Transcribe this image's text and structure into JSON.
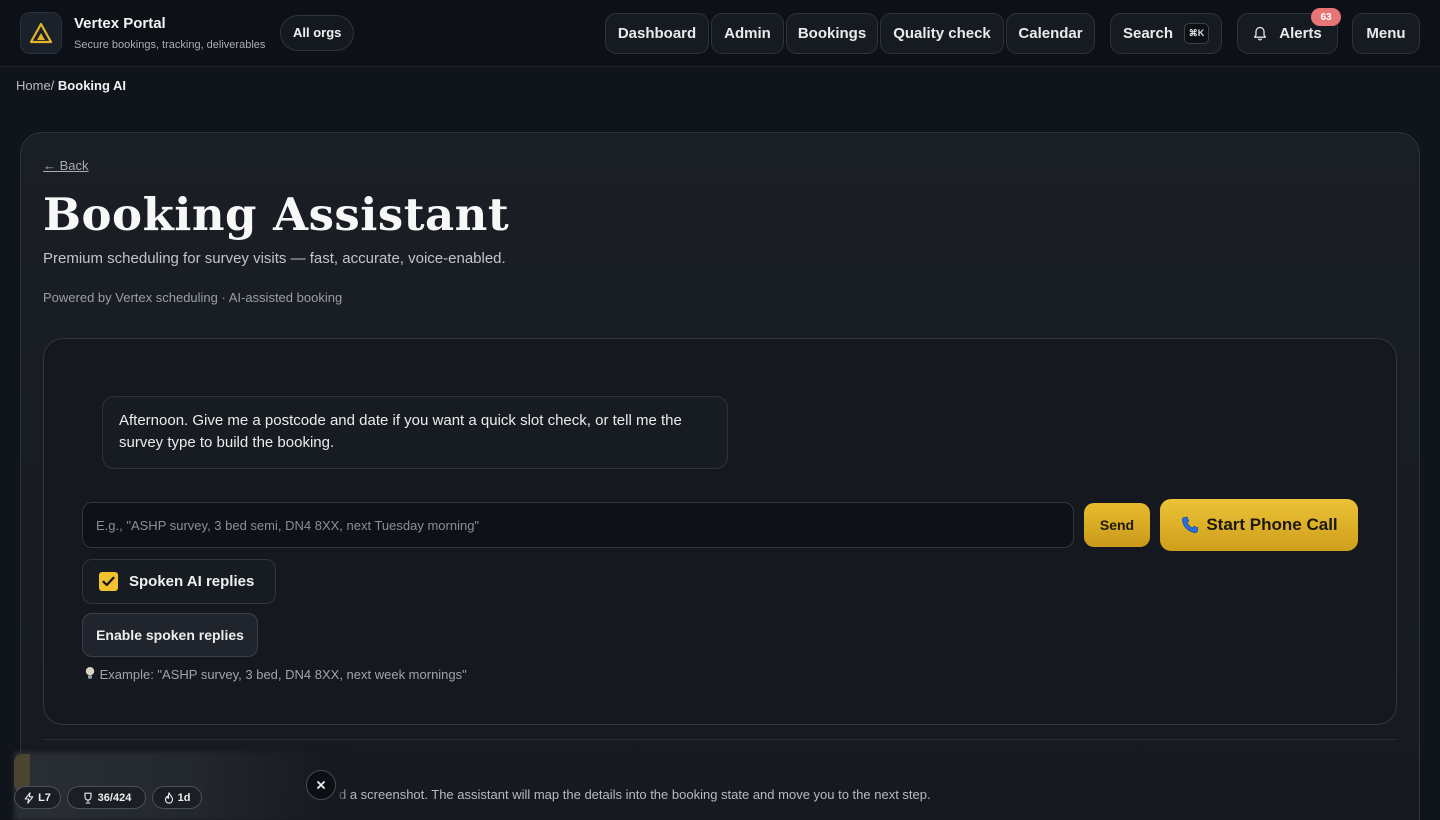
{
  "brand": {
    "title": "Vertex Portal",
    "subtitle": "Secure bookings, tracking, deliverables"
  },
  "org_switcher": {
    "label": "All orgs"
  },
  "nav": {
    "dashboard": "Dashboard",
    "admin": "Admin",
    "bookings": "Bookings",
    "quality_check": "Quality check",
    "calendar": "Calendar",
    "search": "Search",
    "search_shortcut": "⌘K",
    "alerts": "Alerts",
    "alerts_count": "63",
    "menu": "Menu"
  },
  "breadcrumb": {
    "home": "Home/",
    "current": "Booking AI"
  },
  "page": {
    "back": "← Back",
    "title": "Booking Assistant",
    "subtitle": "Premium scheduling for survey visits — fast, accurate, voice-enabled.",
    "powered_by": "Powered by Vertex scheduling · AI-assisted booking"
  },
  "chat": {
    "assistant_message": "Afternoon. Give me a postcode and date if you want a quick slot check, or tell me the survey type to build the booking.",
    "input_value": "",
    "input_placeholder": "E.g., \"ASHP survey, 3 bed semi, DN4 8XX, next Tuesday morning\"",
    "send_label": "Send",
    "call_label": "Start Phone Call",
    "spoken_label": "Spoken AI replies",
    "spoken_checked": true,
    "enable_label": "Enable spoken replies",
    "example": "Example: \"ASHP survey, 3 bed, DN4 8XX, next week mornings\""
  },
  "footer_text": "d a screenshot. The assistant will map the details into the booking state and move you to the next step.",
  "gamification": {
    "level": "L7",
    "trophies": "36/424",
    "streak": "1d"
  },
  "colors": {
    "accent": "#e9bd2f",
    "alert_badge": "#e87575",
    "background": "#10141b"
  }
}
